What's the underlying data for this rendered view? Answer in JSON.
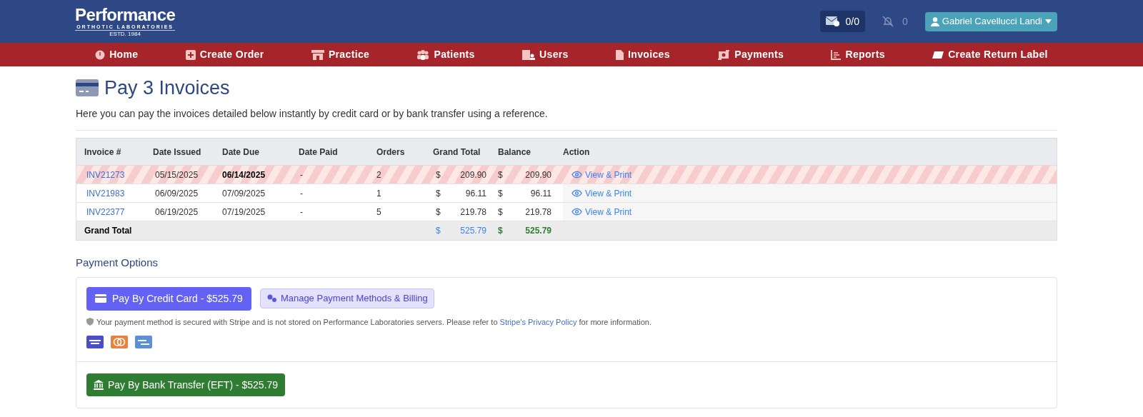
{
  "brand": {
    "name": "Performance",
    "subtitle": "ORTHOTIC LABORATORIES",
    "established": "ESTD. 1984"
  },
  "header": {
    "messages": "0/0",
    "notifications": "0",
    "user": "Gabriel Cavellucci Landi"
  },
  "nav": [
    {
      "label": "Home"
    },
    {
      "label": "Create Order"
    },
    {
      "label": "Practice"
    },
    {
      "label": "Patients"
    },
    {
      "label": "Users"
    },
    {
      "label": "Invoices"
    },
    {
      "label": "Payments"
    },
    {
      "label": "Reports"
    },
    {
      "label": "Create Return Label"
    }
  ],
  "page": {
    "title": "Pay 3 Invoices",
    "description": "Here you can pay the invoices detailed below instantly by credit card or by bank transfer using a reference."
  },
  "table": {
    "columns": [
      "Invoice #",
      "Date Issued",
      "Date Due",
      "Date Paid",
      "Orders",
      "Grand Total",
      "Balance",
      "Action"
    ],
    "rows": [
      {
        "invoice": "INV21273",
        "issued": "05/15/2025",
        "due": "06/14/2025",
        "paid": "-",
        "orders": "2",
        "currency_total": "$",
        "total": "209.90",
        "currency_balance": "$",
        "balance": "209.90",
        "action": "View & Print",
        "overdue": true
      },
      {
        "invoice": "INV21983",
        "issued": "06/09/2025",
        "due": "07/09/2025",
        "paid": "-",
        "orders": "1",
        "currency_total": "$",
        "total": "96.11",
        "currency_balance": "$",
        "balance": "96.11",
        "action": "View & Print",
        "overdue": false
      },
      {
        "invoice": "INV22377",
        "issued": "06/19/2025",
        "due": "07/19/2025",
        "paid": "-",
        "orders": "5",
        "currency_total": "$",
        "total": "219.78",
        "currency_balance": "$",
        "balance": "219.78",
        "action": "View & Print",
        "overdue": false
      }
    ],
    "footer": {
      "label": "Grand Total",
      "currency_total": "$",
      "total": "525.79",
      "currency_balance": "$",
      "balance": "525.79"
    }
  },
  "payment": {
    "heading": "Payment Options",
    "card_button": "Pay By Credit Card - $525.79",
    "manage_button": "Manage Payment Methods & Billing",
    "notice_before": "Your payment method is secured with Stripe and is not stored on Performance Laboratories servers. Please refer to",
    "notice_link": "Stripe's Privacy Policy",
    "notice_after": "for more information.",
    "bank_button": "Pay By Bank Transfer (EFT) - $525.79"
  }
}
